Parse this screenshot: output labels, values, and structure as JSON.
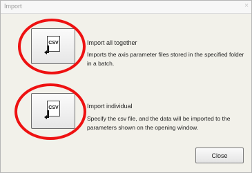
{
  "window": {
    "title": "Import",
    "close_glyph": "×"
  },
  "options": [
    {
      "icon": "csv-import-icon",
      "icon_text": "CSV",
      "title": "Import all together",
      "description": "Imports the axis parameter files stored in the specified folder in a batch."
    },
    {
      "icon": "csv-import-icon",
      "icon_text": "CSV",
      "title": "Import individual",
      "description": "Specify the csv file, and the data will be imported to the parameters shown on the opening window."
    }
  ],
  "footer": {
    "close_label": "Close"
  },
  "colors": {
    "highlight_ring": "#e11111",
    "dialog_bg": "#f2f1ea"
  }
}
